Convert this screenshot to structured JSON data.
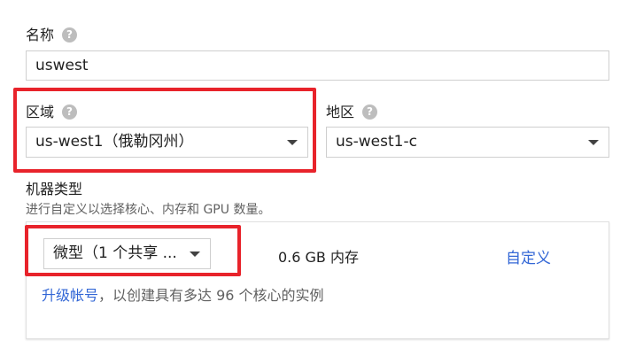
{
  "name_field": {
    "label": "名称",
    "value": "uswest",
    "help_icon": "help-icon"
  },
  "region_field": {
    "label": "区域",
    "value": "us-west1（俄勒冈州）",
    "help_icon": "help-icon"
  },
  "zone_field": {
    "label": "地区",
    "value": "us-west1-c",
    "help_icon": "help-icon"
  },
  "machine_type": {
    "label": "机器类型",
    "hint": "进行自定义以选择核心、内存和 GPU 数量。",
    "select_value": "微型（1 个共享 ...",
    "memory": "0.6 GB 内存",
    "customize_link": "自定义",
    "upgrade_link": "升级帐号",
    "upgrade_text": "，以创建具有多达 96 个核心的实例"
  },
  "colors": {
    "highlight_border": "#e8232b",
    "link": "#3367d6",
    "help_icon": "#bdbdbd"
  }
}
